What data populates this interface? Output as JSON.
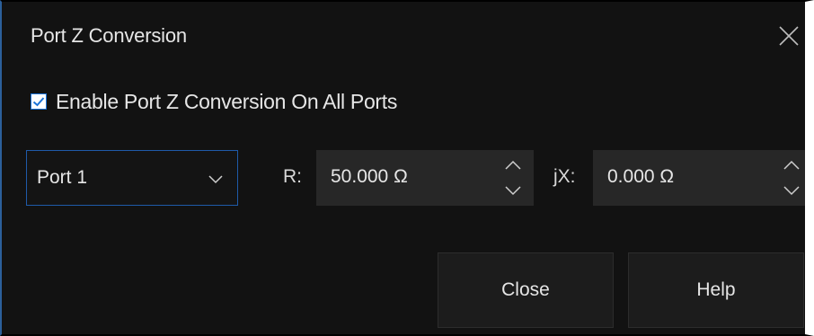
{
  "dialog": {
    "title": "Port Z Conversion",
    "close_icon": "close-icon"
  },
  "enable": {
    "label": "Enable Port Z Conversion On All Ports",
    "checked": true,
    "accent_color": "#1a73d9"
  },
  "port_select": {
    "value": "Port 1",
    "icon": "chevron-down-icon"
  },
  "resistance": {
    "label": "R:",
    "value": "50.000 Ω"
  },
  "reactance": {
    "label": "jX:",
    "value": "0.000 Ω"
  },
  "buttons": {
    "close_label": "Close",
    "help_label": "Help"
  }
}
